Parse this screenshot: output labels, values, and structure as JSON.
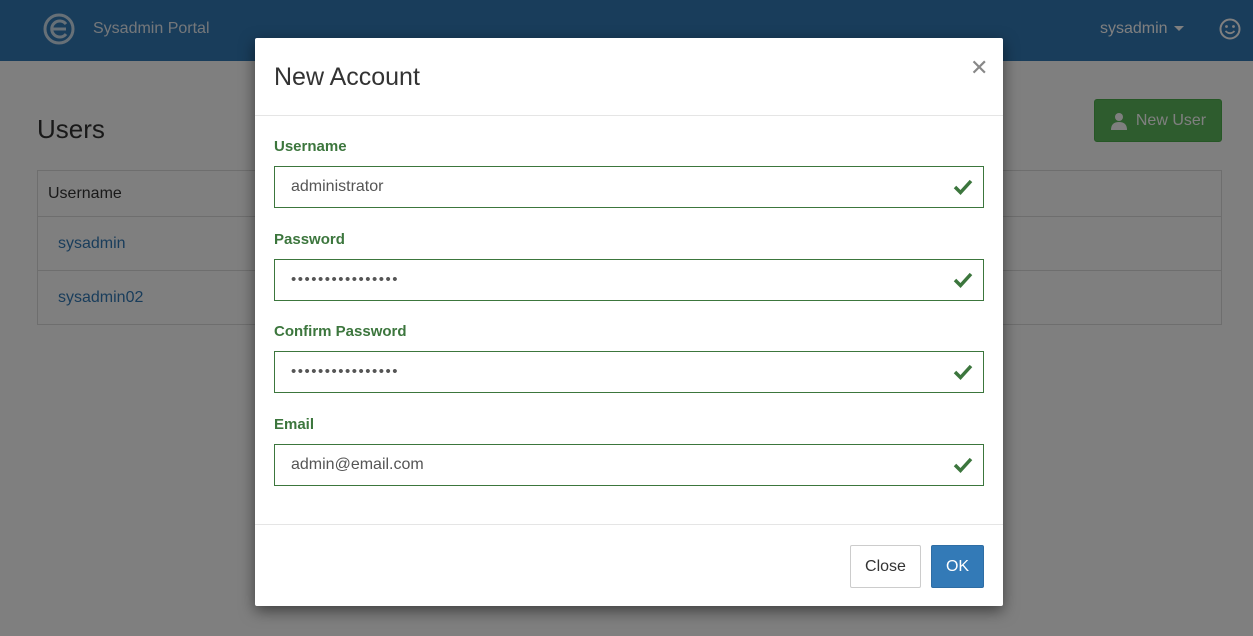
{
  "app": {
    "brand": "Sysadmin Portal",
    "current_user": "sysadmin",
    "icons": {
      "logo": "epsilon-logo-icon",
      "user_menu_caret": "caret-down-icon",
      "profile": "smiley-icon"
    }
  },
  "page": {
    "title": "Users",
    "new_user_button": "New User",
    "new_user_icon": "user-icon",
    "table": {
      "header": "Username",
      "rows": [
        "sysadmin",
        "sysadmin02"
      ]
    }
  },
  "modal": {
    "title": "New Account",
    "close_icon": "close-icon",
    "fields": [
      {
        "label": "Username",
        "value": "administrator",
        "state": "valid"
      },
      {
        "label": "Password",
        "value": "••••••••••••••••",
        "state": "valid"
      },
      {
        "label": "Confirm Password",
        "value": "••••••••••••••••",
        "state": "valid"
      },
      {
        "label": "Email",
        "value": "admin@email.com",
        "state": "valid"
      }
    ],
    "close_button": "Close",
    "ok_button": "OK"
  },
  "colors": {
    "navbar": "#337ab7",
    "success": "#3c763d",
    "primary_button": "#337ab7",
    "new_user_button": "#5cb85c",
    "link": "#337ab7"
  }
}
